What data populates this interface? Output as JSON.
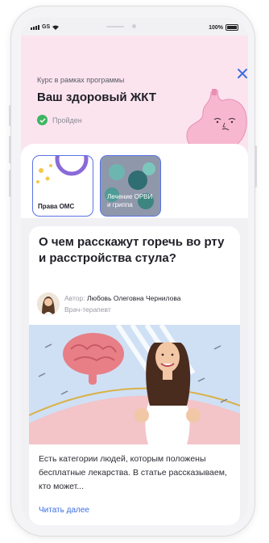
{
  "status_bar": {
    "carrier": "GS",
    "battery": "100%"
  },
  "course": {
    "kicker": "Курс в рамках программы",
    "title": "Ваш здоровый ЖКТ",
    "status": "Пройден"
  },
  "stories": [
    {
      "label": "Права ОМС"
    },
    {
      "label": "Лечение ОРВИ и гриппа"
    }
  ],
  "article": {
    "headline": "О чем расскажут горечь во рту и расстройства стула?",
    "author_prefix": "Автор:",
    "author_name": "Любовь Олеговна Чернилова",
    "author_role": "Врач-терапевт",
    "description": "Есть категории людей, которым положены бесплатные лекарства. В статье рассказываем, кто может...",
    "read_more": "Читать далее"
  },
  "colors": {
    "header_bg": "#fbe4ee",
    "accent_blue": "#3d6fe0",
    "success_green": "#3fb562",
    "story_border": "#5873e6"
  },
  "icons": [
    "signal-icon",
    "wifi-icon",
    "battery-icon",
    "close-icon",
    "check-icon",
    "stomach-illustration",
    "brain-illustration"
  ]
}
